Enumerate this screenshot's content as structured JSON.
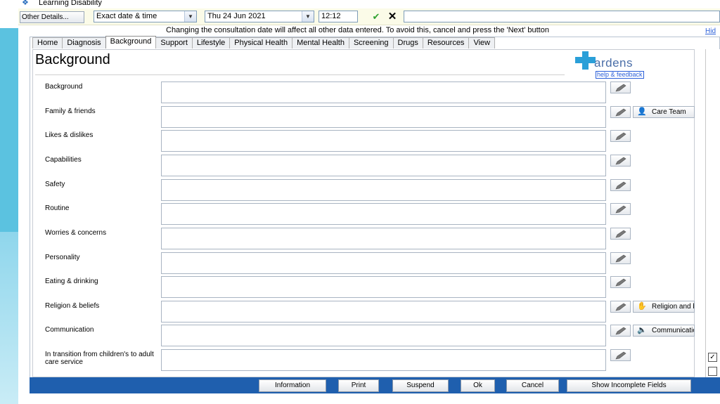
{
  "window": {
    "title": "Learning Disability"
  },
  "toolbar": {
    "other_details_label": "Other Details...",
    "date_mode_value": "Exact date & time",
    "date_value": "Thu 24 Jun 2021",
    "time_value": "12:12"
  },
  "warning_text": "Changing the consultation date will affect all other data entered. To avoid this, cancel and press the 'Next' button",
  "hide_label": "Hid",
  "tabs": [
    {
      "label": "Home"
    },
    {
      "label": "Diagnosis"
    },
    {
      "label": "Background"
    },
    {
      "label": "Support"
    },
    {
      "label": "Lifestyle"
    },
    {
      "label": "Physical Health"
    },
    {
      "label": "Mental Health"
    },
    {
      "label": "Screening"
    },
    {
      "label": "Drugs"
    },
    {
      "label": "Resources"
    },
    {
      "label": "View"
    }
  ],
  "active_tab": "Background",
  "page_title": "Background",
  "logo": {
    "name": "ardens",
    "help_link": "help & feedback"
  },
  "fields": [
    {
      "label": "Background"
    },
    {
      "label": "Family & friends"
    },
    {
      "label": "Likes & dislikes"
    },
    {
      "label": "Capabilities"
    },
    {
      "label": "Safety"
    },
    {
      "label": "Routine"
    },
    {
      "label": "Worries & concerns"
    },
    {
      "label": "Personality"
    },
    {
      "label": "Eating & drinking"
    },
    {
      "label": "Religion & beliefs"
    },
    {
      "label": "Communication"
    },
    {
      "label": "In transition from children's to adult care service"
    }
  ],
  "side_buttons": {
    "care_team": "Care Team",
    "religion": "Religion and beliefs",
    "communication": "Communication"
  },
  "footer": {
    "information": "Information",
    "print": "Print",
    "suspend": "Suspend",
    "ok": "Ok",
    "cancel": "Cancel",
    "show_incomplete": "Show Incomplete Fields"
  },
  "colors": {
    "accent_bar": "#1f5fae",
    "side_decor": "#5bc2e0",
    "logo_blue": "#2a9fd8"
  }
}
